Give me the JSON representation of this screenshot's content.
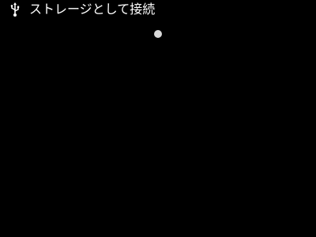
{
  "screen": {
    "background_color": "#000000",
    "title": "ストレージとして接続",
    "title_color": "#ffffff",
    "title_icon": "usb-icon",
    "status_indicator": {
      "icon": "loading-dot",
      "color": "#d8d8d8"
    }
  }
}
